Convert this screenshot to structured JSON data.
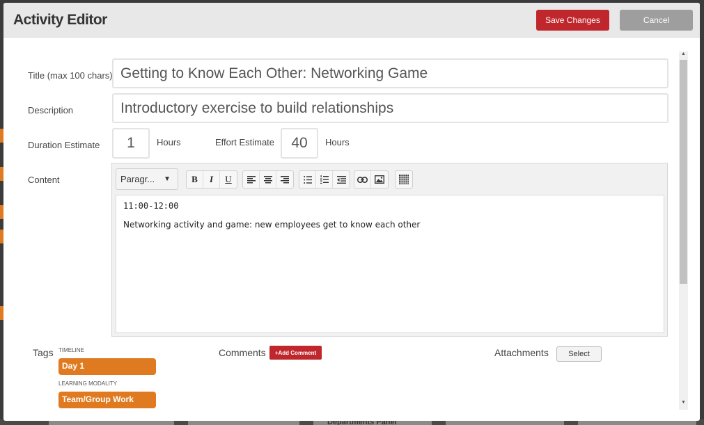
{
  "header": {
    "title": "Activity Editor",
    "save_label": "Save Changes",
    "cancel_label": "Cancel"
  },
  "form": {
    "title_label": "Title (max 100 chars)",
    "title_value": "Getting to Know Each Other: Networking Game",
    "description_label": "Description",
    "description_value": "Introductory exercise to build relationships",
    "duration_label": "Duration Estimate",
    "duration_value": "1",
    "duration_unit": "Hours",
    "effort_label": "Effort Estimate",
    "effort_value": "40",
    "effort_unit": "Hours",
    "content_label": "Content"
  },
  "editor": {
    "format_selected": "Paragr...",
    "toolbar": {
      "bold": "B",
      "italic": "I",
      "underline": "U"
    },
    "lines": [
      "11:00-12:00",
      "Networking activity and game: new employees get to know each other"
    ]
  },
  "tags": {
    "label": "Tags",
    "groups": [
      {
        "heading": "TIMELINE",
        "value": "Day 1"
      },
      {
        "heading": "LEARNING MODALITY",
        "value": "Team/Group Work"
      }
    ]
  },
  "comments": {
    "label": "Comments",
    "add_label": "+Add Comment"
  },
  "attachments": {
    "label": "Attachments",
    "select_label": "Select"
  },
  "background": {
    "card_text": "Departments Panel"
  },
  "colors": {
    "accent_red": "#c0272d",
    "tag_orange": "#e07a20",
    "cancel_gray": "#9e9e9e",
    "header_bg": "#e8e8e8"
  }
}
